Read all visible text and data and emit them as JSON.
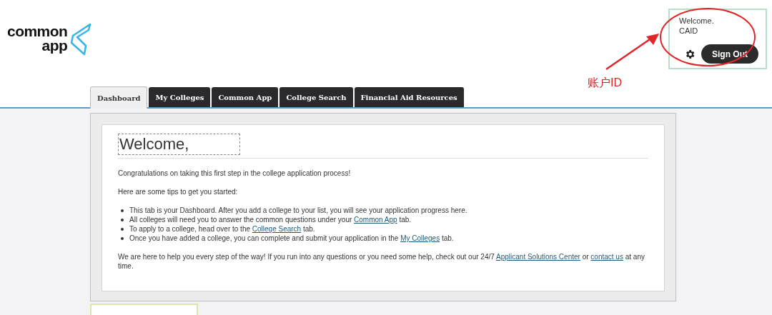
{
  "logo": {
    "line_1": "common",
    "line_2": "app"
  },
  "account": {
    "welcome": "Welcome.",
    "caid": "CAID",
    "sign_out": "Sign Out"
  },
  "annotation": {
    "label": "账户ID"
  },
  "tabs": [
    {
      "label": "Dashboard",
      "selected": true
    },
    {
      "label": "My Colleges",
      "selected": false
    },
    {
      "label": "Common App",
      "selected": false
    },
    {
      "label": "College Search",
      "selected": false
    },
    {
      "label": "Financial Aid Resources",
      "selected": false
    }
  ],
  "dashboard": {
    "heading": "Welcome,",
    "intro": "Congratulations on taking this first step in the college application process!",
    "tips_lead": "Here are some tips to get you started:",
    "tips": [
      [
        {
          "kind": "text",
          "text": "This tab is your Dashboard. After you add a college to your list, you will see your application progress here."
        }
      ],
      [
        {
          "kind": "text",
          "text": "All colleges will need you to answer the common questions under your "
        },
        {
          "kind": "link",
          "text": "Common App"
        },
        {
          "kind": "text",
          "text": " tab."
        }
      ],
      [
        {
          "kind": "text",
          "text": "To apply to a college, head over to the "
        },
        {
          "kind": "link",
          "text": "College Search"
        },
        {
          "kind": "text",
          "text": " tab."
        }
      ],
      [
        {
          "kind": "text",
          "text": "Once you have added a college, you can complete and submit your application in the "
        },
        {
          "kind": "link",
          "text": "My Colleges"
        },
        {
          "kind": "text",
          "text": " tab."
        }
      ]
    ],
    "closing": [
      {
        "kind": "text",
        "text": "We are here to help you every step of the way! If you run into any questions or you need some help, check out our 24/7 "
      },
      {
        "kind": "link",
        "text": "Applicant Solutions Center"
      },
      {
        "kind": "text",
        "text": " or "
      },
      {
        "kind": "link",
        "text": "contact us"
      },
      {
        "kind": "text",
        "text": " at any time."
      }
    ]
  }
}
